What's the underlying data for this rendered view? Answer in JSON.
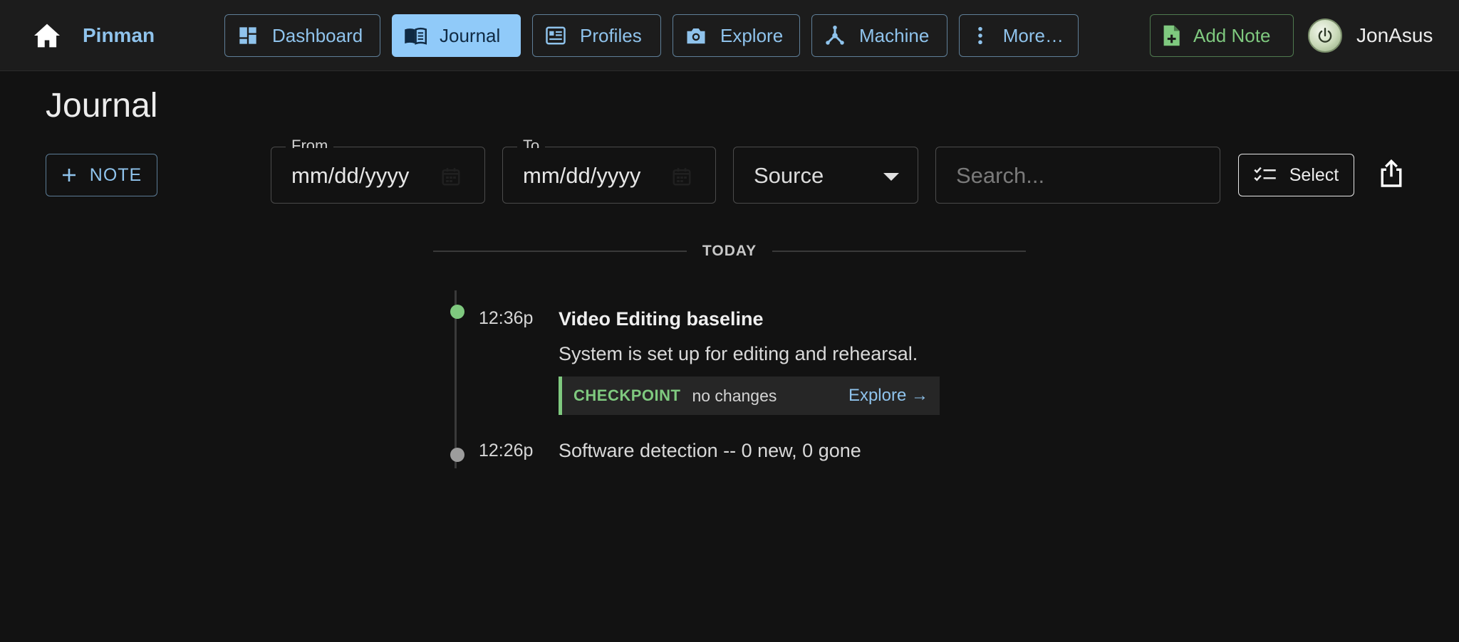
{
  "app": {
    "brand": "Pinman",
    "user": "JonAsus"
  },
  "nav": {
    "items": [
      {
        "label": "Dashboard",
        "icon": "dashboard-icon",
        "active": false
      },
      {
        "label": "Journal",
        "icon": "book-icon",
        "active": true
      },
      {
        "label": "Profiles",
        "icon": "profile-icon",
        "active": false
      },
      {
        "label": "Explore",
        "icon": "camera-icon",
        "active": false
      },
      {
        "label": "Machine",
        "icon": "hub-icon",
        "active": false
      },
      {
        "label": "More…",
        "icon": "more-vertical-icon",
        "active": false
      }
    ],
    "add_note": "Add Note"
  },
  "page": {
    "title": "Journal",
    "note_button": "NOTE"
  },
  "filters": {
    "from_label": "From",
    "from_value": "mm/dd/yyyy",
    "to_label": "To",
    "to_value": "mm/dd/yyyy",
    "source_value": "Source",
    "search_placeholder": "Search...",
    "select_button": "Select"
  },
  "timeline": {
    "group_label": "TODAY",
    "entries": [
      {
        "time": "12:36p",
        "title": "Video Editing baseline",
        "description": "System is set up for editing and rehearsal.",
        "checkpoint_label": "CHECKPOINT",
        "checkpoint_status": "no changes",
        "checkpoint_link": "Explore →",
        "dot_color": "#7fc97f"
      },
      {
        "time": "12:26p",
        "text": "Software detection -- 0 new, 0 gone",
        "dot_color": "#9c9c9c"
      }
    ]
  },
  "colors": {
    "background": "#121212",
    "topbar": "#1c1c1c",
    "accent_blue": "#90caf9",
    "accent_green": "#7fc97f"
  }
}
